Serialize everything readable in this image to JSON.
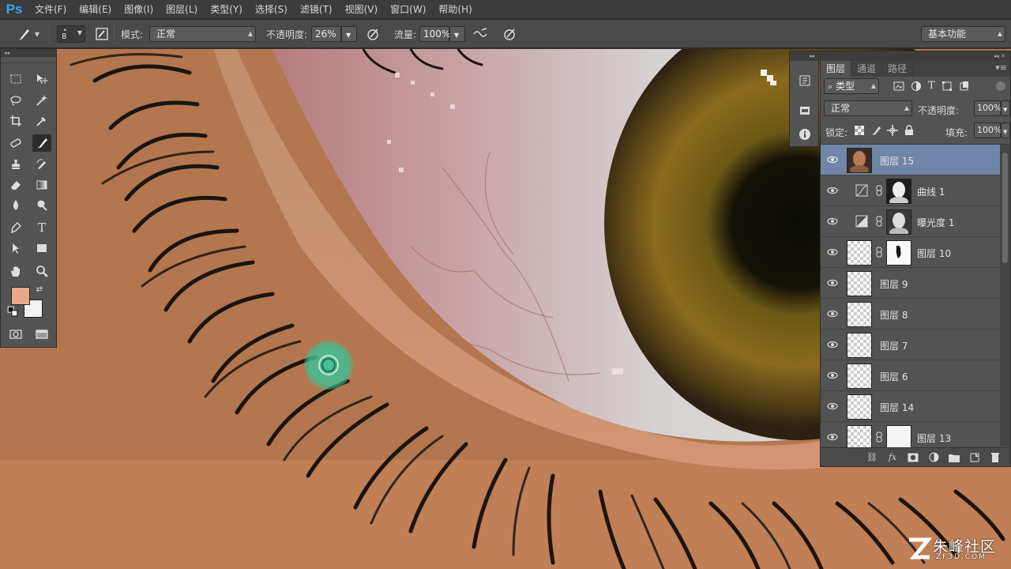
{
  "app": {
    "logo": "Ps"
  },
  "menu": [
    "文件(F)",
    "编辑(E)",
    "图像(I)",
    "图层(L)",
    "类型(Y)",
    "选择(S)",
    "滤镜(T)",
    "视图(V)",
    "窗口(W)",
    "帮助(H)"
  ],
  "options": {
    "brush_size": "8",
    "mode_label": "模式:",
    "mode_value": "正常",
    "opacity_label": "不透明度:",
    "opacity_value": "26%",
    "flow_label": "流量:",
    "flow_value": "100%",
    "workspace": "基本功能"
  },
  "colors": {
    "foreground": "#e8a98a",
    "background": "#f2f2f2",
    "selection": "#6f86a8"
  },
  "layers_panel": {
    "tabs": [
      "图层",
      "通道",
      "路径"
    ],
    "active_tab": "图层",
    "filter_type": "类型",
    "blend_mode": "正常",
    "opacity_label": "不透明度:",
    "opacity_value": "100%",
    "lock_label": "锁定:",
    "fill_label": "填充:",
    "fill_value": "100%",
    "layers": [
      {
        "name": "图层 15",
        "selected": true,
        "kind": "pixel",
        "thumb": "portrait"
      },
      {
        "name": "曲线 1",
        "selected": false,
        "kind": "adjustment",
        "adj_icon": "curves-icon"
      },
      {
        "name": "曝光度 1",
        "selected": false,
        "kind": "adjustment",
        "adj_icon": "exposure-icon"
      },
      {
        "name": "图层 10",
        "selected": false,
        "kind": "masked"
      },
      {
        "name": "图层 9",
        "selected": false,
        "kind": "pixel"
      },
      {
        "name": "图层 8",
        "selected": false,
        "kind": "pixel"
      },
      {
        "name": "图层 7",
        "selected": false,
        "kind": "pixel"
      },
      {
        "name": "图层 6",
        "selected": false,
        "kind": "pixel"
      },
      {
        "name": "图层 14",
        "selected": false,
        "kind": "pixel"
      },
      {
        "name": "图层 13",
        "selected": false,
        "kind": "masked"
      }
    ]
  },
  "watermark": {
    "main": "朱峰社区",
    "sub": "ZF3D.COM"
  }
}
